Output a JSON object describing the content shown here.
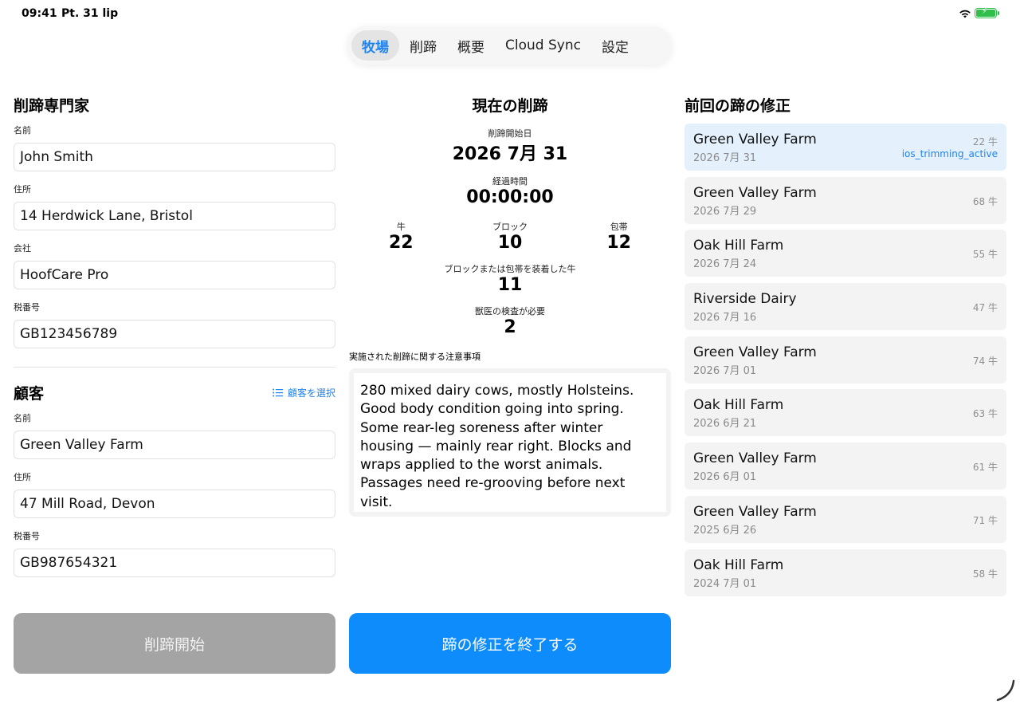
{
  "status": {
    "time": "09:41",
    "date": "Pt. 31 lip"
  },
  "tabs": [
    {
      "label": "牧場",
      "active": true
    },
    {
      "label": "削蹄",
      "active": false
    },
    {
      "label": "概要",
      "active": false
    },
    {
      "label": "Cloud Sync",
      "active": false
    },
    {
      "label": "設定",
      "active": false
    }
  ],
  "trimmer": {
    "title": "削蹄専門家",
    "name_label": "名前",
    "name_value": "John Smith",
    "address_label": "住所",
    "address_value": "14 Herdwick Lane, Bristol",
    "company_label": "会社",
    "company_value": "HoofCare Pro",
    "tax_label": "税番号",
    "tax_value": "GB123456789"
  },
  "customer": {
    "title": "顧客",
    "select_label": "顧客を選択",
    "name_label": "名前",
    "name_value": "Green Valley Farm",
    "address_label": "住所",
    "address_value": "47 Mill Road, Devon",
    "tax_label": "税番号",
    "tax_value": "GB987654321"
  },
  "current": {
    "title": "現在の削蹄",
    "start_label": "削蹄開始日",
    "start_value": "2026 7月 31",
    "elapsed_label": "経過時間",
    "elapsed_value": "00:00:00",
    "cows_label": "牛",
    "cows_value": "22",
    "blocks_label": "ブロック",
    "blocks_value": "10",
    "wraps_label": "包帯",
    "wraps_value": "12",
    "blocked_label": "ブロックまたは包帯を装着した牛",
    "blocked_value": "11",
    "vet_label": "獣医の検査が必要",
    "vet_value": "2",
    "notes_label": "実施された削蹄に関する注意事項",
    "notes_value": "280 mixed dairy cows, mostly Holsteins. Good body condition going into spring. Some rear-leg soreness after winter housing — mainly rear right. Blocks and wraps applied to the worst animals. Passages need re-grooving before next visit."
  },
  "previous": {
    "title": "前回の蹄の修正",
    "records": [
      {
        "name": "Green Valley Farm",
        "date": "2026 7月 31",
        "count": "22 牛",
        "tag": "ios_trimming_active"
      },
      {
        "name": "Green Valley Farm",
        "date": "2026 7月 29",
        "count": "68 牛"
      },
      {
        "name": "Oak Hill Farm",
        "date": "2026 7月 24",
        "count": "55 牛"
      },
      {
        "name": "Riverside Dairy",
        "date": "2026 7月 16",
        "count": "47 牛"
      },
      {
        "name": "Green Valley Farm",
        "date": "2026 7月 01",
        "count": "74 牛"
      },
      {
        "name": "Oak Hill Farm",
        "date": "2026 6月 21",
        "count": "63 牛"
      },
      {
        "name": "Green Valley Farm",
        "date": "2026 6月 01",
        "count": "61 牛"
      },
      {
        "name": "Green Valley Farm",
        "date": "2025 6月 26",
        "count": "71 牛"
      },
      {
        "name": "Oak Hill Farm",
        "date": "2024 7月 01",
        "count": "58 牛"
      }
    ]
  },
  "buttons": {
    "start_label": "削蹄開始",
    "finish_label": "蹄の修正を終了する"
  },
  "colors": {
    "accent": "#1d84f0",
    "primary_button": "#0f8cfb",
    "disabled_button": "#a4a4a4",
    "active_row": "#e4f1fd"
  }
}
